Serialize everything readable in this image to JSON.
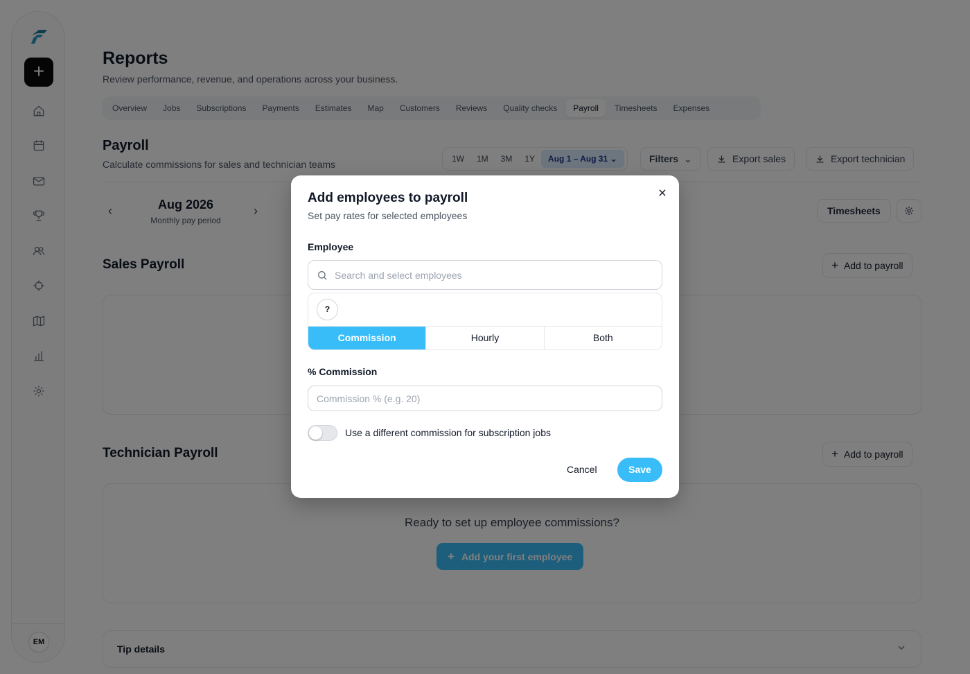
{
  "brand": {
    "accent": "#38bdf8",
    "overlay": "rgba(0,0,0,0.5)"
  },
  "sidebar": {
    "new_label": "+",
    "icons": [
      "home-icon",
      "calendar-icon",
      "mail-icon",
      "trophy-icon",
      "users-icon",
      "crosshair-icon",
      "map-icon",
      "chart-icon",
      "gear-icon"
    ],
    "avatar": "EM"
  },
  "header": {
    "title": "Reports",
    "subtitle": "Review performance, revenue, and operations across your business."
  },
  "tabs": [
    {
      "label": "Overview"
    },
    {
      "label": "Jobs"
    },
    {
      "label": "Subscriptions"
    },
    {
      "label": "Payments"
    },
    {
      "label": "Estimates"
    },
    {
      "label": "Map"
    },
    {
      "label": "Customers"
    },
    {
      "label": "Reviews"
    },
    {
      "label": "Quality checks"
    },
    {
      "label": "Payroll",
      "active": true
    },
    {
      "label": "Timesheets"
    },
    {
      "label": "Expenses"
    }
  ],
  "payroll": {
    "title": "Payroll",
    "subtitle": "Calculate commissions for sales and technician teams",
    "ranges": [
      "1W",
      "1M",
      "3M",
      "1Y"
    ],
    "date_range": "Aug 1 – Aug 31",
    "filters": "Filters",
    "export_sales": "Export sales",
    "export_technician": "Export technician",
    "period_title": "Aug 2026",
    "period_sub": "Monthly pay period",
    "timesheets": "Timesheets"
  },
  "sales": {
    "title": "Sales Payroll",
    "add": "Add to payroll"
  },
  "technician": {
    "title": "Technician Payroll",
    "add": "Add to payroll",
    "empty": "Ready to set up employee commissions?",
    "cta": "Add your first employee"
  },
  "tip": {
    "label": "Tip details"
  },
  "modal": {
    "title": "Add employees to payroll",
    "subtitle": "Set pay rates for selected employees",
    "employee_label": "Employee",
    "search_placeholder": "Search and select employees",
    "chip": "?",
    "segments": [
      {
        "label": "Commission",
        "active": true
      },
      {
        "label": "Hourly"
      },
      {
        "label": "Both"
      }
    ],
    "commission_label": "% Commission",
    "commission_placeholder": "Commission % (e.g. 20)",
    "toggle_label": "Use a different commission for subscription jobs",
    "toggle_on": false,
    "cancel": "Cancel",
    "save": "Save"
  }
}
